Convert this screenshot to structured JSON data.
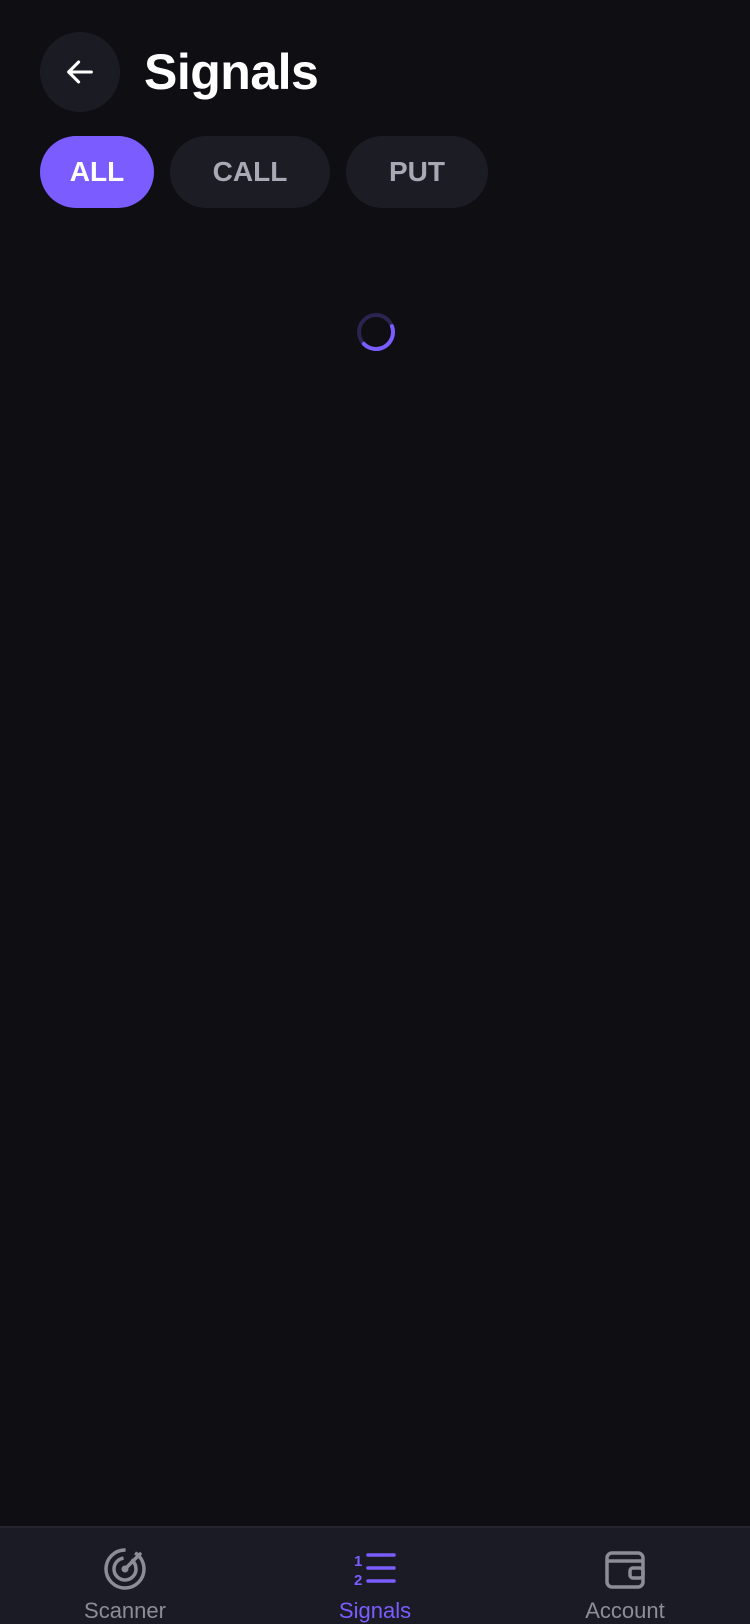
{
  "header": {
    "title": "Signals"
  },
  "filters": [
    {
      "label": "ALL",
      "active": true
    },
    {
      "label": "CALL",
      "active": false
    },
    {
      "label": "PUT",
      "active": false
    }
  ],
  "colors": {
    "accent": "#7b5cff",
    "background": "#0e0e13",
    "chip": "#1c1c25",
    "nav_inactive": "#8d8d99"
  },
  "bottom_nav": {
    "items": [
      {
        "label": "Scanner",
        "icon": "radar-icon",
        "active": false
      },
      {
        "label": "Signals",
        "icon": "numbered-list-icon",
        "active": true
      },
      {
        "label": "Account",
        "icon": "wallet-icon",
        "active": false
      }
    ]
  }
}
